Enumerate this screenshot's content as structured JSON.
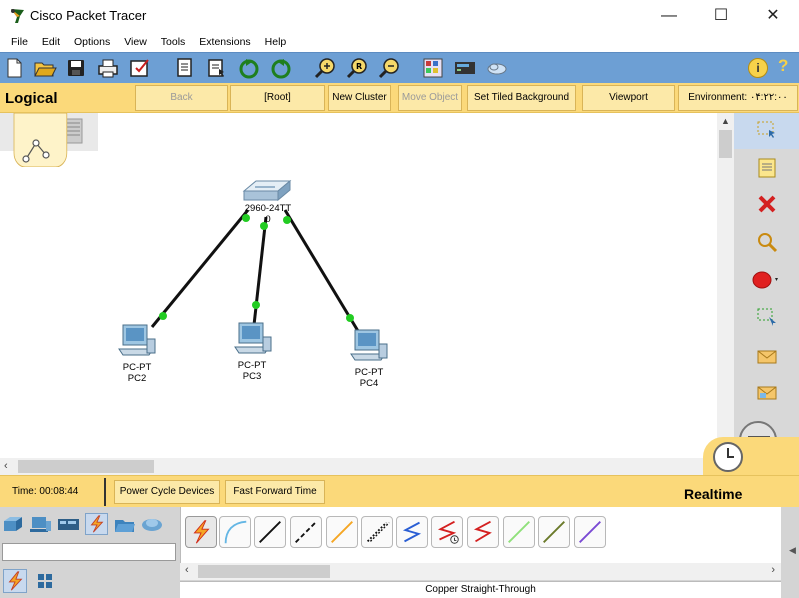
{
  "window": {
    "title": "Cisco Packet Tracer",
    "minimize": "—",
    "maximize": "☐",
    "close": "✕"
  },
  "menu": [
    "File",
    "Edit",
    "Options",
    "View",
    "Tools",
    "Extensions",
    "Help"
  ],
  "toolbar": {
    "icons": [
      "new-icon",
      "open-icon",
      "save-icon",
      "print-icon",
      "activity-wizard-icon",
      "copy-icon",
      "paste-icon",
      "undo-icon",
      "redo-icon",
      "zoom-in-icon",
      "zoom-reset-icon",
      "zoom-out-icon",
      "palette-icon",
      "custom-device-icon",
      "cloud-icon"
    ],
    "info_label": "i",
    "help_label": "?"
  },
  "logical_bar": {
    "label": "Logical",
    "buttons": [
      {
        "label": "Back",
        "enabled": false
      },
      {
        "label": "[Root]",
        "enabled": true
      },
      {
        "label": "New Cluster",
        "enabled": true
      },
      {
        "label": "Move Object",
        "enabled": false
      },
      {
        "label": "Set Tiled Background",
        "enabled": true
      },
      {
        "label": "Viewport",
        "enabled": true
      },
      {
        "label": "Environment: ۰۴:۲۲:۰۰",
        "enabled": true
      }
    ]
  },
  "workspace": {
    "devices": [
      {
        "name": "switch0",
        "label_line1": "2960-24TT",
        "label_line2": "0"
      },
      {
        "name": "pc2",
        "label_line1": "PC-PT",
        "label_line2": "PC2"
      },
      {
        "name": "pc3",
        "label_line1": "PC-PT",
        "label_line2": "PC3"
      },
      {
        "name": "pc4",
        "label_line1": "PC-PT",
        "label_line2": "PC4"
      }
    ],
    "link_status_color": "#22cc22"
  },
  "right_palette": [
    "select-icon",
    "note-icon",
    "delete-icon",
    "inspect-icon",
    "draw-shape-icon",
    "resize-icon",
    "add-simple-pdu-icon",
    "add-complex-pdu-icon"
  ],
  "time_bar": {
    "time": "Time: 00:08:44",
    "power_cycle": "Power Cycle Devices",
    "fast_forward": "Fast Forward Time",
    "mode": "Realtime"
  },
  "bottom": {
    "device_categories": [
      "network-devices-icon",
      "end-devices-icon",
      "components-icon",
      "connections-icon",
      "miscellaneous-icon",
      "multiuser-icon"
    ],
    "sub_categories": [
      "connections-icon",
      "grid-icon"
    ],
    "connections": [
      "automatic-connection",
      "console",
      "copper-straight-through",
      "copper-cross-over",
      "fiber",
      "phone",
      "coaxial",
      "serial-dce",
      "serial-dte",
      "octal",
      "iot-custom-cable",
      "usb"
    ],
    "selected_connection_name": "Copper Straight-Through"
  }
}
